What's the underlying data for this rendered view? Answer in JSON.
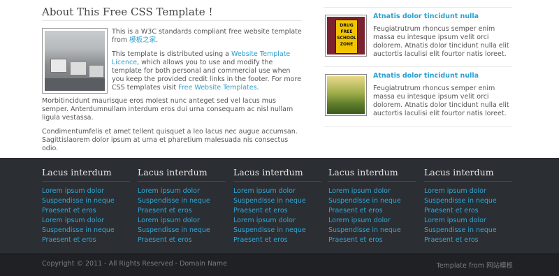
{
  "about": {
    "title": "About This Free CSS Template !",
    "p1_text": "This is a W3C standards compliant free website template from ",
    "p1_link": "模板之家",
    "p1_end": ".",
    "p2_a": "This template is distributed using a ",
    "p2_link1": "Website Template Licence",
    "p2_b": ", which allows you to use and modify the template for both personal and commercial use when you keep the provided credit links in the footer. For more CSS templates visit ",
    "p2_link2": "Free Website Templates",
    "p2_end": ".",
    "p3": "Morbitincidunt maurisque eros molest nunc anteget sed vel lacus mus semper. Anterdumnullam interdum eros dui urna consequam ac nisl nullam ligula vestassa.",
    "p4": "Condimentumfelis et amet tellent quisquet a leo lacus nec augue accumsan. Sagittislaorem dolor ipsum at urna et pharetium malesuada nis consectus odio."
  },
  "news": [
    {
      "title": "Atnatis dolor tincidunt nulla",
      "text": "Feugiatrutrum rhoncus semper enim massa eu intesque ipsum velit orci dolorem. Atnatis dolor tincidunt nulla elit auctortis laculisi elit fourtor natis loreet."
    },
    {
      "title": "Atnatis dolor tincidunt nulla",
      "text": "Feugiatrutrum rhoncus semper enim massa eu intesque ipsum velit orci dolorem. Atnatis dolor tincidunt nulla elit auctortis laculisi elit fourtor natis loreet."
    }
  ],
  "footer_columns": [
    {
      "heading": "Lacus interdum",
      "links": [
        "Lorem ipsum dolor",
        "Suspendisse in neque",
        "Praesent et eros",
        "Lorem ipsum dolor",
        "Suspendisse in neque",
        "Praesent et eros"
      ]
    },
    {
      "heading": "Lacus interdum",
      "links": [
        "Lorem ipsum dolor",
        "Suspendisse in neque",
        "Praesent et eros",
        "Lorem ipsum dolor",
        "Suspendisse in neque",
        "Praesent et eros"
      ]
    },
    {
      "heading": "Lacus interdum",
      "links": [
        "Lorem ipsum dolor",
        "Suspendisse in neque",
        "Praesent et eros",
        "Lorem ipsum dolor",
        "Suspendisse in neque",
        "Praesent et eros"
      ]
    },
    {
      "heading": "Lacus interdum",
      "links": [
        "Lorem ipsum dolor",
        "Suspendisse in neque",
        "Praesent et eros",
        "Lorem ipsum dolor",
        "Suspendisse in neque",
        "Praesent et eros"
      ]
    },
    {
      "heading": "Lacus interdum",
      "links": [
        "Lorem ipsum dolor",
        "Suspendisse in neque",
        "Praesent et eros",
        "Lorem ipsum dolor",
        "Suspendisse in neque",
        "Praesent et eros"
      ]
    }
  ],
  "footer": {
    "copyright": "Copyright © 2011 - All Rights Reserved - Domain Name",
    "credit": "Template from 网站模板"
  },
  "colors": {
    "link": "#2b9fd0",
    "footer_bg": "#2b2e33",
    "bottom_bg": "#1f2124"
  }
}
